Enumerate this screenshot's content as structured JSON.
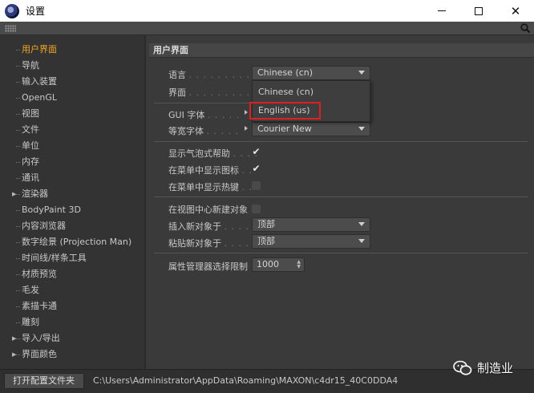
{
  "window": {
    "title": "设置"
  },
  "sidebar": {
    "items": [
      {
        "label": "用户界面",
        "active": true,
        "expandable": false
      },
      {
        "label": "导航",
        "active": false,
        "expandable": false
      },
      {
        "label": "输入装置",
        "active": false,
        "expandable": false
      },
      {
        "label": "OpenGL",
        "active": false,
        "expandable": false
      },
      {
        "label": "视图",
        "active": false,
        "expandable": false
      },
      {
        "label": "文件",
        "active": false,
        "expandable": false
      },
      {
        "label": "单位",
        "active": false,
        "expandable": false
      },
      {
        "label": "内存",
        "active": false,
        "expandable": false
      },
      {
        "label": "通讯",
        "active": false,
        "expandable": false
      },
      {
        "label": "渲染器",
        "active": false,
        "expandable": true
      },
      {
        "label": "BodyPaint 3D",
        "active": false,
        "expandable": false
      },
      {
        "label": "内容浏览器",
        "active": false,
        "expandable": false
      },
      {
        "label": "数字绘景 (Projection Man)",
        "active": false,
        "expandable": false
      },
      {
        "label": "时间线/样条工具",
        "active": false,
        "expandable": false
      },
      {
        "label": "材质预览",
        "active": false,
        "expandable": false
      },
      {
        "label": "毛发",
        "active": false,
        "expandable": false
      },
      {
        "label": "素描卡通",
        "active": false,
        "expandable": false
      },
      {
        "label": "雕刻",
        "active": false,
        "expandable": false
      },
      {
        "label": "导入/导出",
        "active": false,
        "expandable": true
      },
      {
        "label": "界面颜色",
        "active": false,
        "expandable": true
      }
    ]
  },
  "main": {
    "group_title": "用户界面",
    "language": {
      "label": "语言",
      "value": "Chinese (cn)"
    },
    "interface": {
      "label": "界面"
    },
    "gui_font": {
      "label": "GUI 字体"
    },
    "mono_font": {
      "label": "等宽字体",
      "value": "Courier New"
    },
    "tooltips": {
      "label": "显示气泡式帮助",
      "checked": true
    },
    "menu_icons": {
      "label": "在菜单中显示图标",
      "checked": true
    },
    "menu_hotkeys": {
      "label": "在菜单中显示热键",
      "checked": false
    },
    "create_center": {
      "label": "在视图中心新建对象",
      "checked": false
    },
    "insert_at": {
      "label": "插入新对象于",
      "value": "顶部"
    },
    "paste_at": {
      "label": "粘贴新对象于",
      "value": "顶部"
    },
    "attr_limit": {
      "label": "属性管理器选择限制",
      "value": "1000"
    },
    "language_popup": {
      "options": [
        "Chinese (cn)",
        "English (us)"
      ],
      "highlighted": "English (us)"
    }
  },
  "statusbar": {
    "button_label": "打开配置文件夹",
    "path": "C:\\Users\\Administrator\\AppData\\Roaming\\MAXON\\c4dr15_40C0DDA4"
  },
  "watermark": {
    "text": "制造业"
  },
  "colors": {
    "accent": "#f5a623",
    "highlight_border": "#e02020",
    "panel": "#3a3a3a",
    "sidebar": "#333333"
  }
}
